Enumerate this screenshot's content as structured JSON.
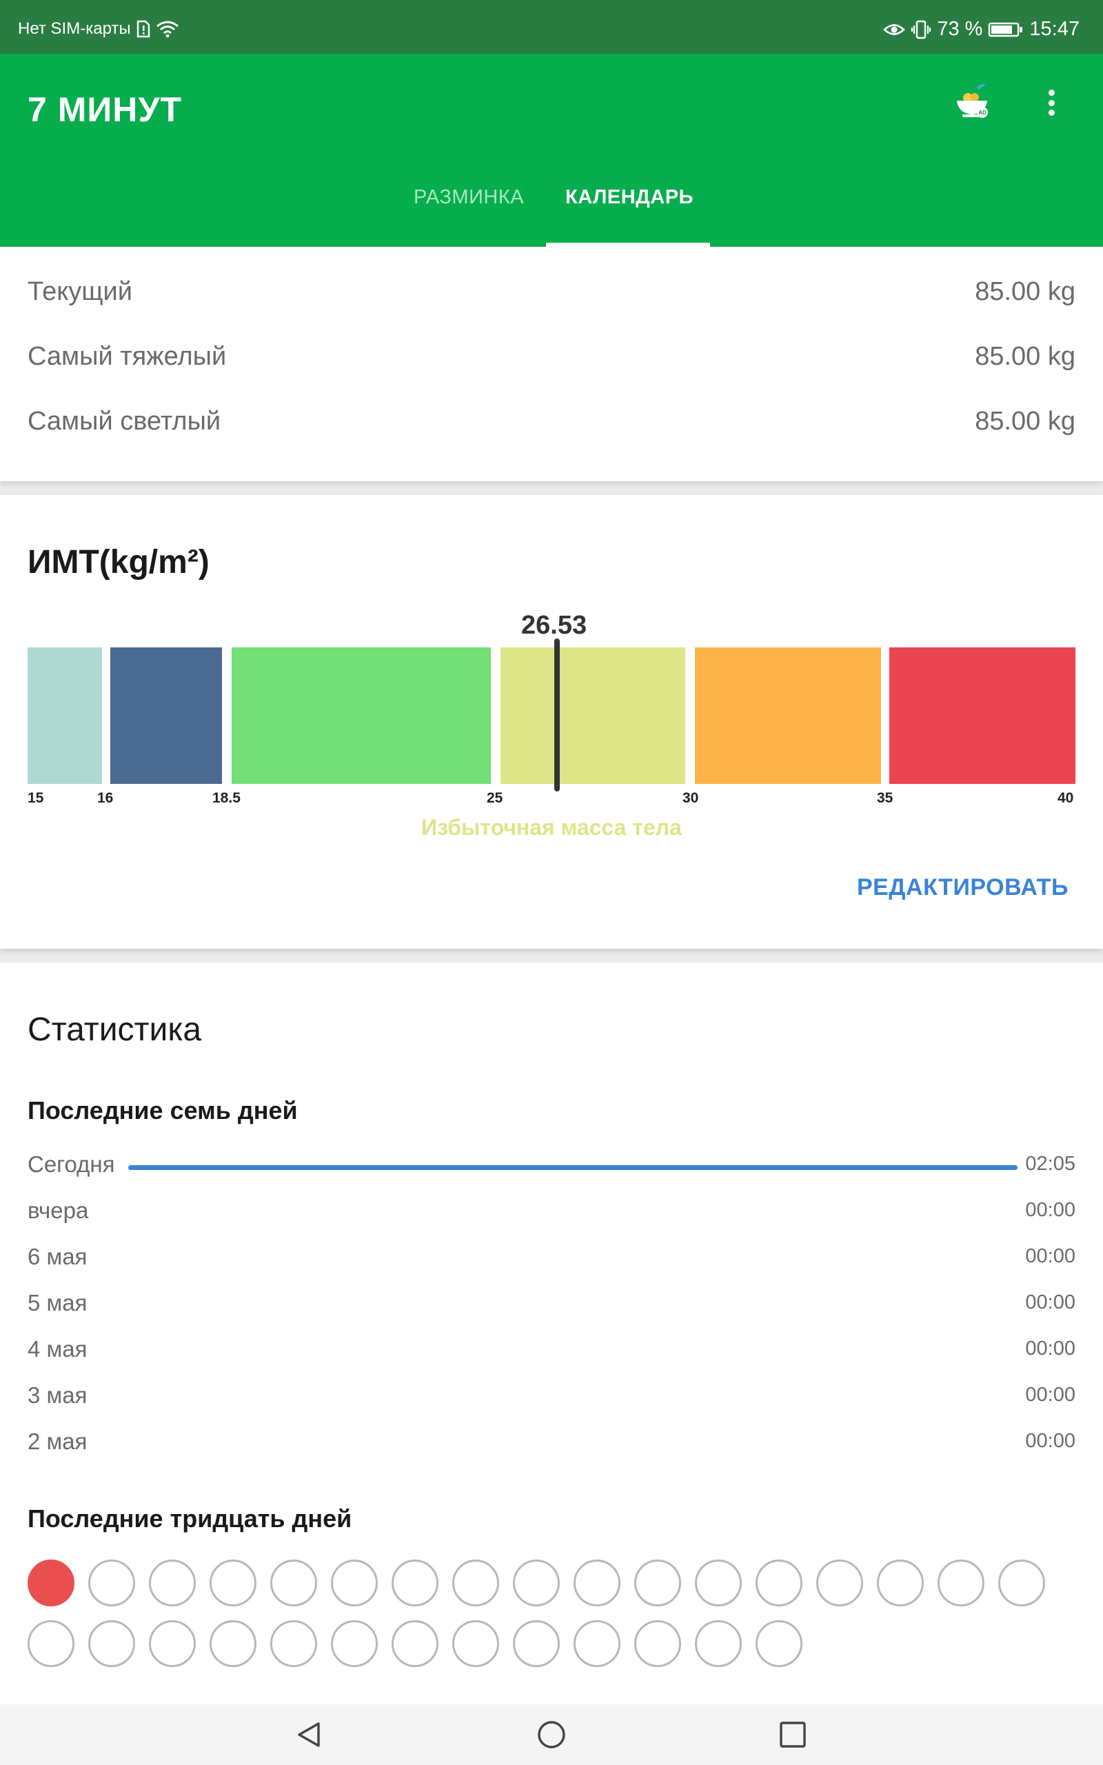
{
  "status_bar": {
    "carrier": "Нет SIM-карты",
    "battery": "73 %",
    "time": "15:47"
  },
  "app": {
    "title": "7 МИНУТ",
    "tabs": [
      {
        "label": "РАЗМИНКА",
        "active": false
      },
      {
        "label": "КАЛЕНДАРЬ",
        "active": true
      }
    ],
    "primary_color": "#06ad4d"
  },
  "weights": [
    {
      "label": "Текущий",
      "value": "85.00 kg"
    },
    {
      "label": "Самый тяжелый",
      "value": "85.00 kg"
    },
    {
      "label": "Самый светлый",
      "value": "85.00 kg"
    }
  ],
  "bmi": {
    "title": "ИМТ(kg/m²)",
    "value": "26.53",
    "ticks": [
      "15",
      "16",
      "18.5",
      "25",
      "30",
      "35",
      "40"
    ],
    "segment_colors": [
      "#b0d8d3",
      "#4b6a91",
      "#74de77",
      "#dde587",
      "#fdb348",
      "#ea4451"
    ],
    "category": "Избыточная масса тела",
    "edit_label": "РЕДАКТИРОВАТЬ"
  },
  "stats": {
    "title": "Статистика",
    "last7_title": "Последние семь дней",
    "days": [
      {
        "label": "Сегодня",
        "value": "02:05",
        "progress": 1.0
      },
      {
        "label": "вчера",
        "value": "00:00",
        "progress": 0
      },
      {
        "label": "6 мая",
        "value": "00:00",
        "progress": 0
      },
      {
        "label": "5 мая",
        "value": "00:00",
        "progress": 0
      },
      {
        "label": "4 мая",
        "value": "00:00",
        "progress": 0
      },
      {
        "label": "3 мая",
        "value": "00:00",
        "progress": 0
      },
      {
        "label": "2 мая",
        "value": "00:00",
        "progress": 0
      }
    ],
    "last30_title": "Последние тридцать дней",
    "days_completed": 1,
    "days_total": 30
  }
}
